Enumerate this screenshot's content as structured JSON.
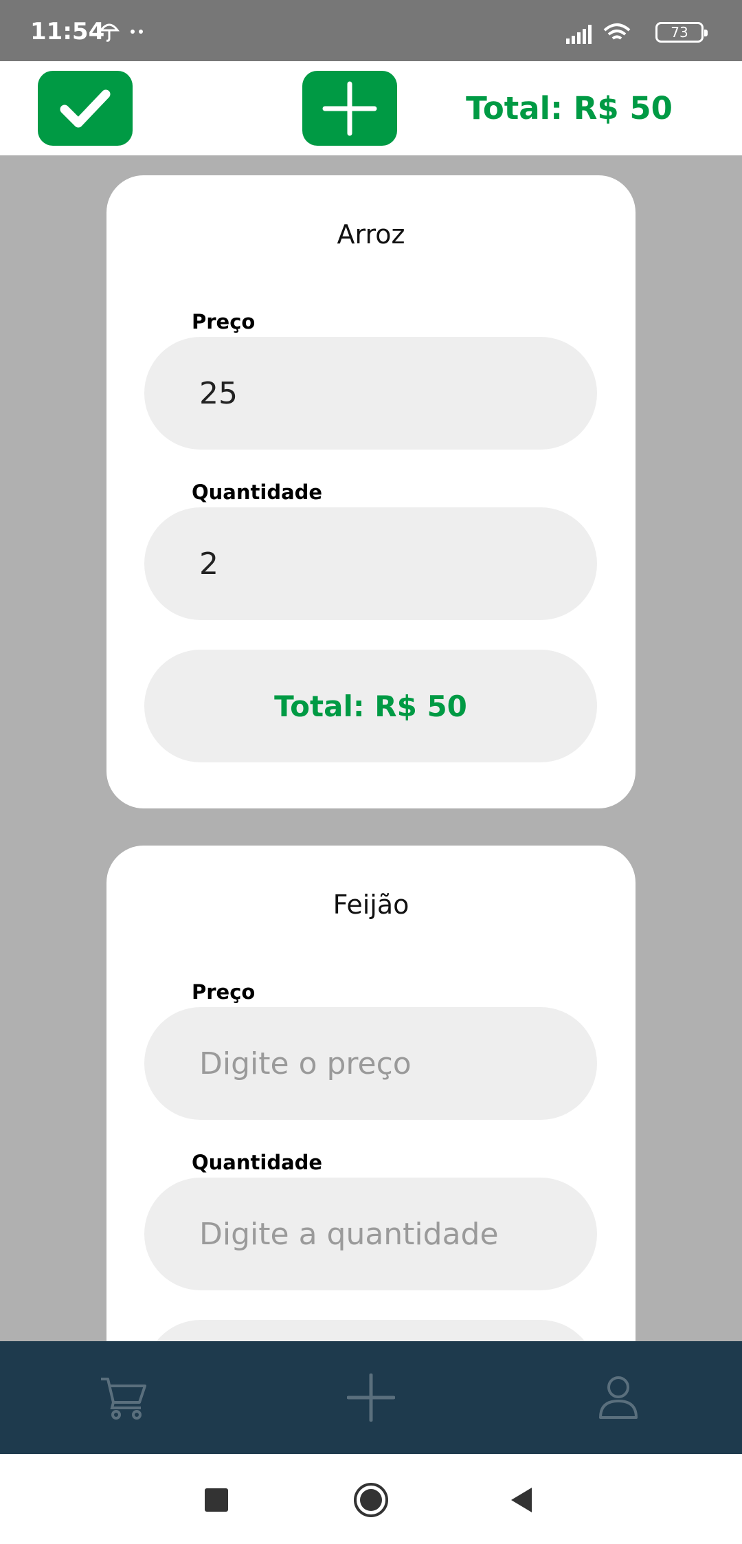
{
  "status": {
    "time": "11:54",
    "battery": "73"
  },
  "top_bar": {
    "total": "Total: R$ 50"
  },
  "cards": [
    {
      "title": "Arroz",
      "price_label": "Preço",
      "price_value": "25",
      "price_placeholder": "Digite o preço",
      "quantity_label": "Quantidade",
      "quantity_value": "2",
      "quantity_placeholder": "Digite a quantidade",
      "total": "Total: R$ 50"
    },
    {
      "title": "Feijão",
      "price_label": "Preço",
      "price_value": "",
      "price_placeholder": "Digite o preço",
      "quantity_label": "Quantidade",
      "quantity_value": "",
      "quantity_placeholder": "Digite a quantidade"
    }
  ],
  "icons": {
    "confirm": "check-icon",
    "add": "plus-icon",
    "cart": "cart-icon",
    "nav_add": "plus-icon",
    "profile": "user-icon"
  },
  "colors": {
    "accent": "#009a44",
    "nav_bg": "#1e3a4d",
    "background": "#b0b0b0"
  }
}
